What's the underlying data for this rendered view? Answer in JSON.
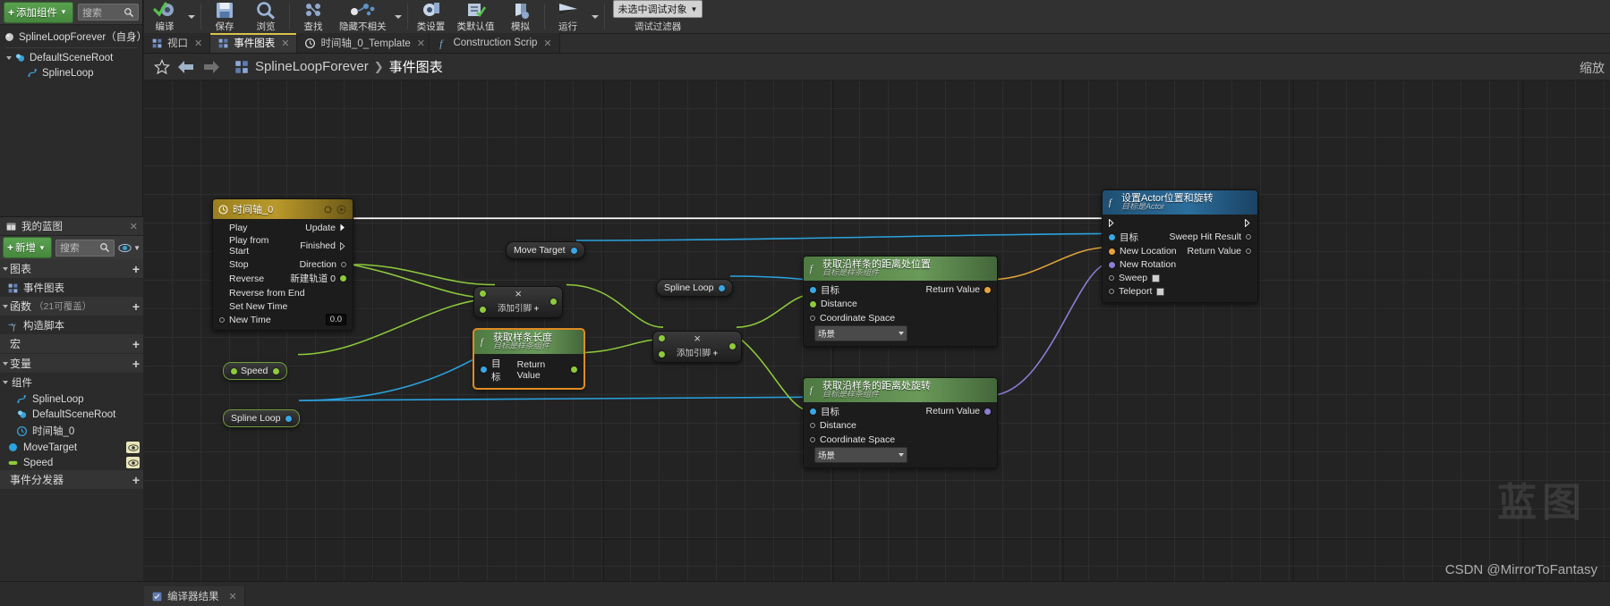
{
  "components_panel": {
    "add_button": "添加组件",
    "search_placeholder": "搜索",
    "tree": [
      {
        "label": "SplineLoopForever（自身）",
        "icon": "sphere-icon",
        "indent": 0
      },
      {
        "label": "DefaultSceneRoot",
        "icon": "scene-root-icon",
        "indent": 1
      },
      {
        "label": "SplineLoop",
        "icon": "spline-icon",
        "indent": 2
      }
    ]
  },
  "toolbar": {
    "items": [
      {
        "label": "编译",
        "icon": "compile-icon",
        "has_dropdown": true
      },
      {
        "label": "保存",
        "icon": "save-icon",
        "has_dropdown": false
      },
      {
        "label": "浏览",
        "icon": "browse-icon",
        "has_dropdown": false
      },
      {
        "label": "查找",
        "icon": "find-icon",
        "has_dropdown": false
      },
      {
        "label": "隐藏不相关",
        "icon": "hide-unrelated-icon",
        "has_dropdown": true
      },
      {
        "label": "类设置",
        "icon": "class-settings-icon",
        "has_dropdown": false
      },
      {
        "label": "类默认值",
        "icon": "class-defaults-icon",
        "has_dropdown": false
      },
      {
        "label": "模拟",
        "icon": "simulate-icon",
        "has_dropdown": false
      },
      {
        "label": "运行",
        "icon": "play-icon",
        "has_dropdown": true
      }
    ],
    "debug": {
      "combo_value": "未选中调试对象",
      "label": "调试过滤器"
    }
  },
  "graph_tabs": [
    {
      "label": "视口",
      "icon": "viewport-icon",
      "active": false,
      "closable": true
    },
    {
      "label": "事件图表",
      "icon": "graph-icon",
      "active": true,
      "closable": true
    },
    {
      "label": "时间轴_0_Template",
      "icon": "timeline-icon",
      "active": false,
      "closable": true
    },
    {
      "label": "Construction Scrip",
      "icon": "function-icon",
      "active": false,
      "closable": true
    }
  ],
  "breadcrumb": {
    "root": "SplineLoopForever",
    "separator": "❯",
    "current": "事件图表",
    "zoom_label": "缩放"
  },
  "my_blueprint": {
    "tab_title": "我的蓝图",
    "add_button": "新增",
    "search_placeholder": "搜索",
    "sections": [
      {
        "title": "图表",
        "sub": "",
        "items": [
          {
            "label": "事件图表",
            "icon": "graph-icon"
          }
        ]
      },
      {
        "title": "函数",
        "sub": "（21可覆盖）",
        "items": [
          {
            "label": "构造脚本",
            "icon": "construction-script-icon"
          }
        ]
      },
      {
        "title": "宏",
        "sub": "",
        "items": []
      },
      {
        "title": "变量",
        "sub": "",
        "items": []
      }
    ],
    "components_group": {
      "title": "组件",
      "items": [
        {
          "label": "SplineLoop",
          "icon": "spline-icon",
          "badge": false
        },
        {
          "label": "DefaultSceneRoot",
          "icon": "scene-root-icon",
          "badge": false
        },
        {
          "label": "时间轴_0",
          "icon": "timeline-icon",
          "badge": false
        },
        {
          "label": "MoveTarget",
          "icon": "object-var-icon",
          "badge": true
        },
        {
          "label": "Speed",
          "icon": "float-var-icon",
          "badge": true
        }
      ]
    },
    "event_dispatchers": {
      "title": "事件分发器"
    }
  },
  "graph": {
    "nodes": {
      "timeline": {
        "title": "时间轴_0",
        "inputs": [
          "Play",
          "Play from Start",
          "Stop",
          "Reverse",
          "Reverse from End",
          "Set New Time"
        ],
        "new_time_label": "New Time",
        "new_time_value": "0.0",
        "outputs": [
          "Update",
          "Finished",
          "Direction",
          "新建轨道 0"
        ]
      },
      "move_target": {
        "label": "Move Target"
      },
      "spline_loop_top": {
        "label": "Spline Loop"
      },
      "spline_loop_bottom": {
        "label": "Spline Loop"
      },
      "speed": {
        "label": "Speed"
      },
      "multiply_top": {
        "symbol": "×",
        "add_pin": "添加引脚"
      },
      "multiply_bottom": {
        "symbol": "×",
        "add_pin": "添加引脚"
      },
      "get_spline_length": {
        "title": "获取样条长度",
        "subtitle": "目标是样条组件",
        "input": "目标",
        "output": "Return Value"
      },
      "get_location_at_distance": {
        "title": "获取沿样条的距离处位置",
        "subtitle": "目标是样条组件",
        "inputs": [
          "目标",
          "Distance"
        ],
        "coordinate_space_label": "Coordinate Space",
        "coordinate_space_value": "场景",
        "output": "Return Value"
      },
      "get_rotation_at_distance": {
        "title": "获取沿样条的距离处旋转",
        "subtitle": "目标是样条组件",
        "inputs": [
          "目标",
          "Distance"
        ],
        "coordinate_space_label": "Coordinate Space",
        "coordinate_space_value": "场景",
        "output": "Return Value"
      },
      "set_actor_transform": {
        "title": "设置Actor位置和旋转",
        "subtitle": "目标是Actor",
        "inputs": [
          "目标",
          "New Location",
          "New Rotation",
          "Sweep",
          "Teleport"
        ],
        "outputs": [
          "Sweep Hit Result",
          "Return Value"
        ]
      }
    }
  },
  "bottom_bar": {
    "tab_label": "编译器结果",
    "icon": "compiler-results-icon"
  },
  "watermark": {
    "big": "蓝图",
    "small": "CSDN @MirrorToFantasy"
  },
  "colors": {
    "exec_wire": "#ffffff",
    "object_wire": "#2aa3e0",
    "float_wire": "#8ecb3c",
    "vector_wire": "#e0a338",
    "rotator_wire": "#8a7fd4",
    "accent_green": "#59a14f",
    "timeline_head": "#b9992a",
    "selection": "#e08b22"
  }
}
